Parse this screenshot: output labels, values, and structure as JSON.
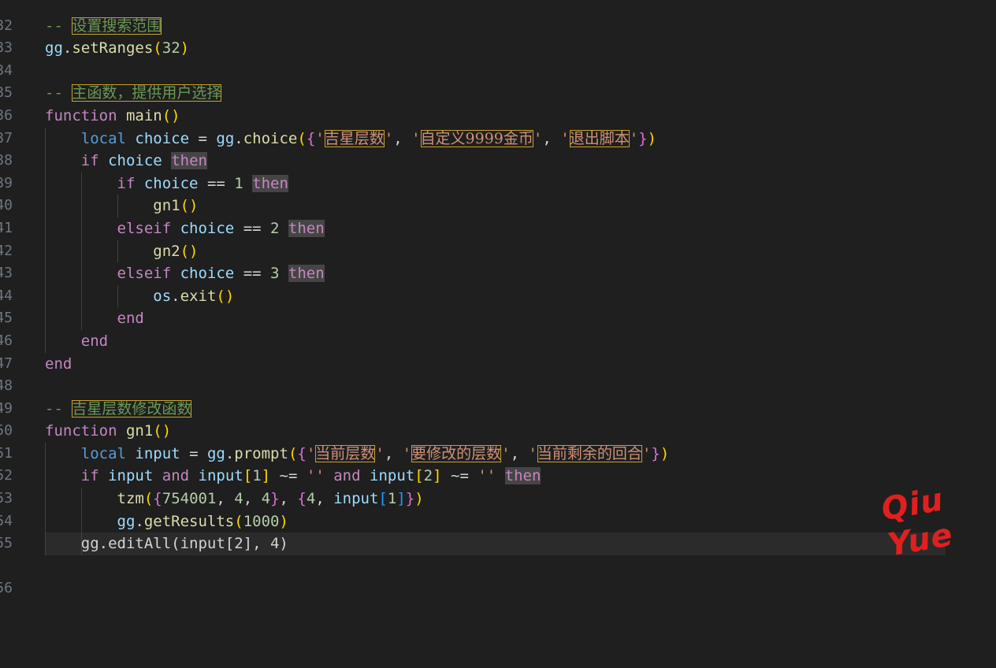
{
  "editor": {
    "line_numbers": [
      "32",
      "33",
      "34",
      "35",
      "36",
      "37",
      "38",
      "39",
      "40",
      "41",
      "42",
      "43",
      "44",
      "45",
      "46",
      "47",
      "48",
      "49",
      "50",
      "51",
      "52",
      "53",
      "54",
      "55",
      "56"
    ],
    "comments": {
      "search_range": "设置搜索范围",
      "main_func": "主函数，提供用户选择",
      "gn1_func": "吉星层数修改函数"
    },
    "choice_options": [
      "吉星层数",
      "自定义9999金币",
      "退出脚本"
    ],
    "prompt_options": [
      "当前层数",
      "要修改的层数",
      "当前剩余的回合"
    ],
    "numbers": {
      "ranges": "32",
      "c1": "1",
      "c2": "2",
      "c3": "3",
      "tzm_id": "754001",
      "tzm_a": "4",
      "tzm_b": "4",
      "tzm_c": "4",
      "input_idx1": "1",
      "input_idx2": "2",
      "results": "1000"
    },
    "partial_last_line": "    gg.editAll(input[2], 4)"
  },
  "watermark": "Qiu Yue",
  "colors": {
    "background": "#1f1f1f",
    "keyword": "#c586c0",
    "string": "#ce9178",
    "comment": "#6a9955",
    "watermark": "#e0201f"
  }
}
